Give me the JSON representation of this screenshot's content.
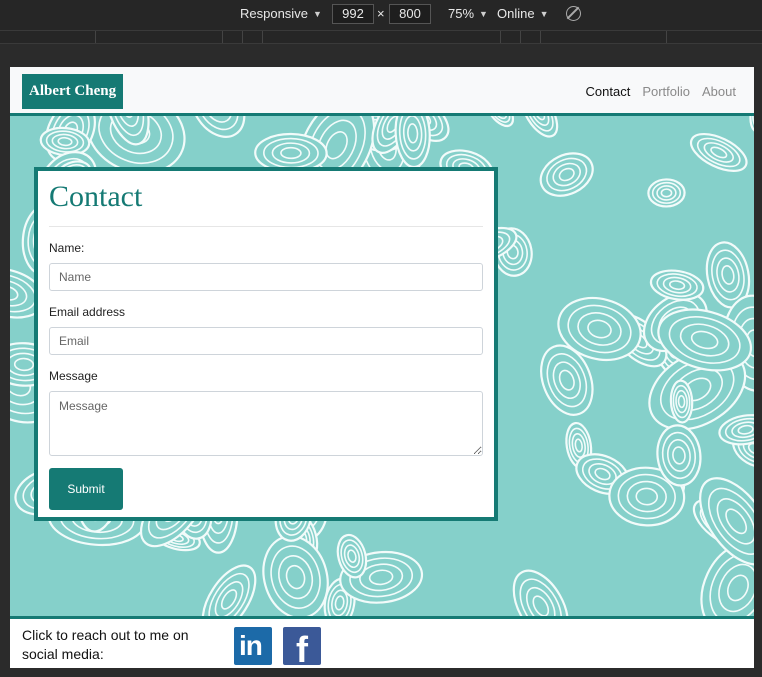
{
  "devtools": {
    "device": "Responsive",
    "width": "992",
    "height": "800",
    "times": "×",
    "zoom": "75%",
    "network": "Online"
  },
  "navbar": {
    "brand": "Albert Cheng",
    "links": [
      {
        "label": "Contact",
        "active": true
      },
      {
        "label": "Portfolio",
        "active": false
      },
      {
        "label": "About",
        "active": false
      }
    ]
  },
  "contact": {
    "title": "Contact",
    "name_label": "Name:",
    "name_placeholder": "Name",
    "email_label": "Email address",
    "email_placeholder": "Email",
    "message_label": "Message",
    "message_placeholder": "Message",
    "submit_label": "Submit"
  },
  "footer": {
    "text": "Click to reach out to me on social media:",
    "social": [
      {
        "icon": "linkedin-icon",
        "glyph": "in",
        "color": "#1c6aa8"
      },
      {
        "icon": "facebook-icon",
        "glyph": "f",
        "color": "#3b5998"
      }
    ]
  },
  "colors": {
    "accent": "#157a74",
    "pattern": "#85d0ca"
  }
}
